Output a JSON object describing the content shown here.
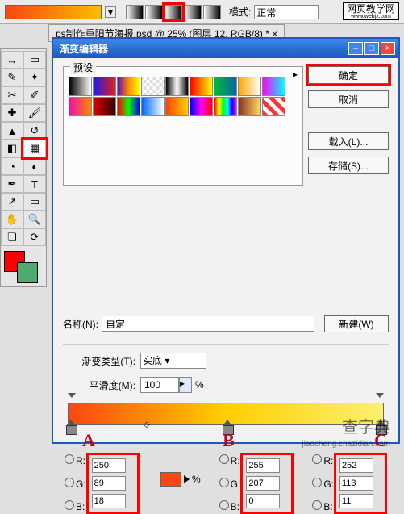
{
  "top": {
    "mode_label": "模式:",
    "mode_value": "正常",
    "watermark_line1": "网页教学网",
    "watermark_line2": "www.webjx.com"
  },
  "doc_tab": "ps制作重阳节海报.psd @ 25% (图层 12, RGB/8) * ×",
  "dialog": {
    "title": "渐变编辑器",
    "presets_label": "预设",
    "ok": "确定",
    "cancel": "取消",
    "load": "载入(L)...",
    "save": "存储(S)...",
    "name_label": "名称(N):",
    "name_value": "自定",
    "new_btn": "新建(W)",
    "grad_type_label": "渐变类型(T):",
    "grad_type_value": "实底",
    "smooth_label": "平滑度(M):",
    "smooth_value": "100",
    "percent": "%"
  },
  "letters": {
    "a": "A",
    "b": "B",
    "c": "C"
  },
  "rgb": {
    "A": {
      "r": "250",
      "g": "89",
      "b": "18"
    },
    "B": {
      "r": "255",
      "g": "207",
      "b": "0"
    },
    "C": {
      "r": "252",
      "g": "113",
      "b": "11"
    }
  },
  "rgb_labels": {
    "r": "R:",
    "g": "G:",
    "b": "B:"
  },
  "watermark_main": "查字典",
  "watermark_sub": "jiaocheng.chazidian.com"
}
